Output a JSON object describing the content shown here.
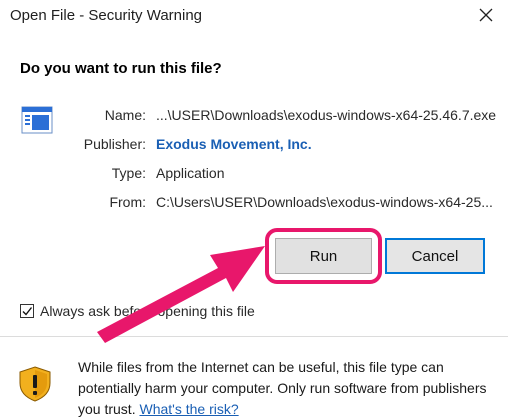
{
  "window": {
    "title": "Open File - Security Warning",
    "close_icon": "close-icon"
  },
  "prompt": {
    "question": "Do you want to run this file?"
  },
  "file": {
    "icon": "executable-file-icon",
    "details": [
      {
        "label": "Name:",
        "value": "...\\USER\\Downloads\\exodus-windows-x64-25.46.7.exe"
      },
      {
        "label": "Publisher:",
        "value": "Exodus Movement, Inc."
      },
      {
        "label": "Type:",
        "value": "Application"
      },
      {
        "label": "From:",
        "value": "C:\\Users\\USER\\Downloads\\exodus-windows-x64-25..."
      }
    ]
  },
  "buttons": {
    "run": "Run",
    "cancel": "Cancel"
  },
  "checkbox": {
    "label": "Always ask before opening this file",
    "checked": true
  },
  "warning": {
    "icon": "shield-warning-icon",
    "text": "While files from the Internet can be useful, this file type can potentially harm your computer. Only run software from publishers you trust.",
    "link": "What's the risk?"
  },
  "annotation": {
    "highlight_color": "#e8176b",
    "arrow_color": "#e8176b"
  }
}
